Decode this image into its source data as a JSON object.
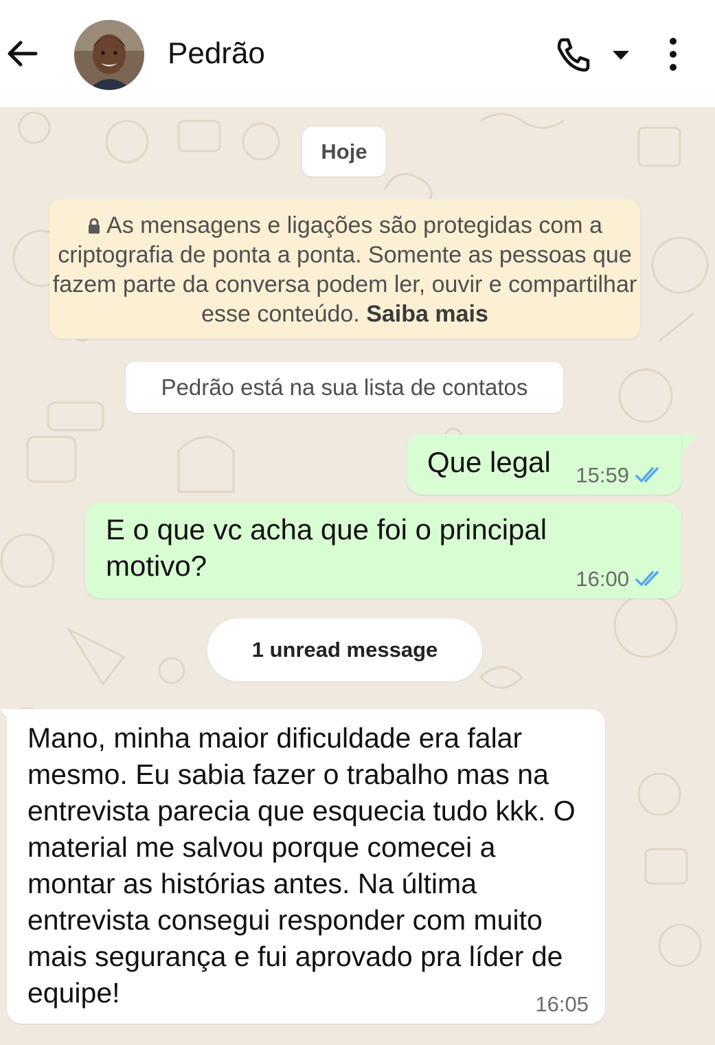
{
  "header": {
    "back_icon": "arrow-left-icon",
    "contact_name": "Pedrão",
    "call_icon": "phone-icon",
    "call_options_icon": "caret-down-icon",
    "menu_icon": "more-vertical-icon"
  },
  "chat": {
    "date_label": "Hoje",
    "encryption_notice": {
      "icon": "lock-icon",
      "text": "As mensagens e ligações são protegidas com a criptografia de ponta a ponta. Somente as pessoas que fazem parte da conversa podem ler, ouvir e compartilhar esse conteúdo.",
      "link": "Saiba mais"
    },
    "contact_notice": "Pedrão está na sua lista de contatos",
    "messages": [
      {
        "direction": "outgoing",
        "text": "Que legal",
        "time": "15:59",
        "status": "read"
      },
      {
        "direction": "outgoing",
        "text": "E o que vc acha que foi o principal motivo?",
        "time": "16:00",
        "status": "read"
      },
      {
        "direction": "incoming",
        "text": "Mano, minha maior dificuldade era falar mesmo. Eu sabia fazer o trabalho mas na entrevista parecia que esquecia tudo kkk. O material me salvou porque comecei a montar as histórias antes. Na última entrevista consegui responder com muito mais segurança e fui aprovado pra líder de equipe!",
        "time": "16:05"
      }
    ],
    "unread_label": "1 unread message"
  },
  "colors": {
    "outgoing_bubble": "#d9fdd3",
    "incoming_bubble": "#ffffff",
    "notice_bg": "#fcf0d4",
    "read_ticks": "#53a6f0",
    "wallpaper": "#efe9df"
  }
}
